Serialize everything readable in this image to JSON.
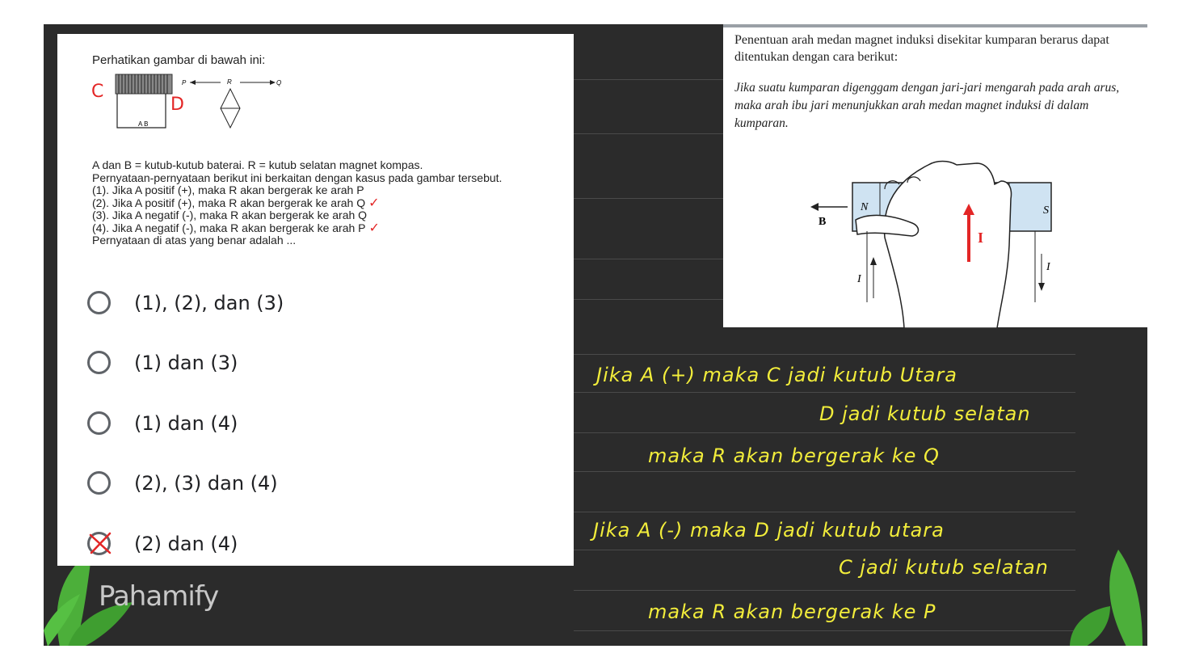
{
  "question": {
    "heading": "Perhatikan gambar di bawah ini:",
    "diagram": {
      "label_c": "C",
      "label_d": "D",
      "label_p": "P",
      "label_r": "R",
      "label_q": "Q",
      "label_ab": "A  B"
    },
    "lines": [
      "A dan B = kutub-kutub baterai. R = kutub selatan magnet kompas.",
      "Pernyataan-pernyataan berikut ini berkaitan dengan kasus pada gambar tersebut.",
      "(1). Jika A positif (+), maka R akan bergerak ke arah P",
      "(2). Jika A positif (+), maka R akan bergerak ke arah Q",
      "(3). Jika A negatif (-), maka R akan bergerak ke arah Q",
      "(4). Jika A negatif (-), maka R akan bergerak ke arah P",
      "Pernyataan di atas yang benar adalah ..."
    ],
    "check_mark": "✓",
    "options": [
      {
        "label": "(1), (2), dan (3)",
        "state": "empty"
      },
      {
        "label": "(1) dan (3)",
        "state": "empty"
      },
      {
        "label": "(1) dan (4)",
        "state": "empty"
      },
      {
        "label": "(2), (3) dan (4)",
        "state": "empty"
      },
      {
        "label": "(2) dan (4)",
        "state": "crossed"
      }
    ]
  },
  "theory": {
    "text": "Penentuan arah medan magnet induksi disekitar kumparan berarus dapat ditentukan dengan cara berikut:",
    "italic": "Jika suatu kumparan digenggam dengan jari-jari mengarah pada arah arus, maka arah ibu jari menunjukkan arah medan magnet induksi di dalam kumparan.",
    "figure": {
      "b": "B",
      "n": "N",
      "s": "S",
      "i_big": "I",
      "i_left": "I",
      "i_right": "I"
    }
  },
  "handwriting": {
    "line1": "Jika A (+) maka C jadi kutub Utara",
    "line2": "D jadi kutub selatan",
    "line3": "maka R akan bergerak ke Q",
    "line4": "Jika A (-) maka D jadi kutub utara",
    "line5": "C jadi kutub selatan",
    "line6": "maka R akan bergerak ke P"
  },
  "brand": "Pahamify",
  "colors": {
    "board": "#2b2b2b",
    "handwriting": "#f2ed3b",
    "check": "#e32626",
    "leaf": "#4caf3a"
  }
}
